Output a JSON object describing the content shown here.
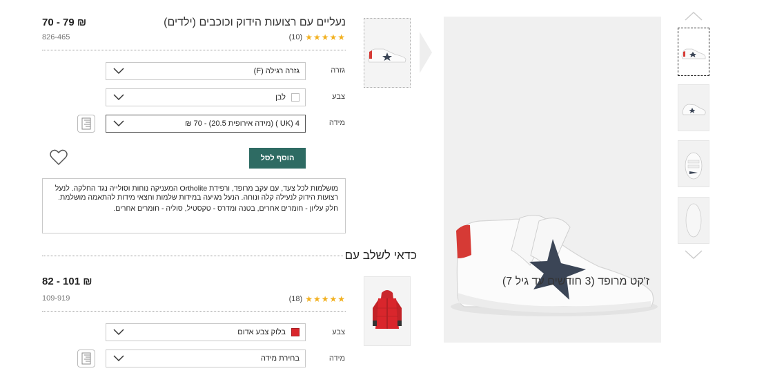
{
  "product": {
    "title": "נעליים עם רצועות הידוק וכוכבים  (ילדים)",
    "price": "70 - 79 ₪",
    "sku": "826-465",
    "stars": "★★★★★",
    "reviews": "(10)",
    "fit_label": "גזרה",
    "fit_value": "גזרה רגילה (F)",
    "color_label": "צבע",
    "color_value": "לבן",
    "color_swatch": "#ffffff",
    "size_label": "מידה",
    "size_value": "4 (UK ) (מידה אירופית 20.5) - 70 ₪",
    "add_to_cart": "הוסף לסל",
    "description_1": "מושלמות לכל צעד, עם עקב מרופד, ורפידת Ortholite המעניקה נוחות וסולייה נגד החלקה. לנעל רצועות הידוק לנעילה קלה ונוחה. הנעל מגיעה במידות שלמות וחצאי מידות להתאמה מושלמת.",
    "description_2": "חלק עליון - חומרים אחרים, בטנה ומדרס - טקסטיל, סוליה - חומרים אחרים."
  },
  "pairing": {
    "section_title": "כדאי לשלב עם",
    "title": "ז'קט מרופד (3 חודשים עד גיל 7)",
    "price": "82 - 101 ₪",
    "sku": "109-919",
    "stars": "★★★★★",
    "reviews": "(18)",
    "color_label": "צבע",
    "color_value": "בלוק צבע אדום",
    "color_swatch": "#d9262c",
    "size_label": "מידה",
    "size_value": "בחירת מידה"
  },
  "colors": {
    "accent": "#2e6b63",
    "star": "#f2b01e",
    "shoe_red": "#d63a35",
    "shoe_star": "#3b4556"
  }
}
